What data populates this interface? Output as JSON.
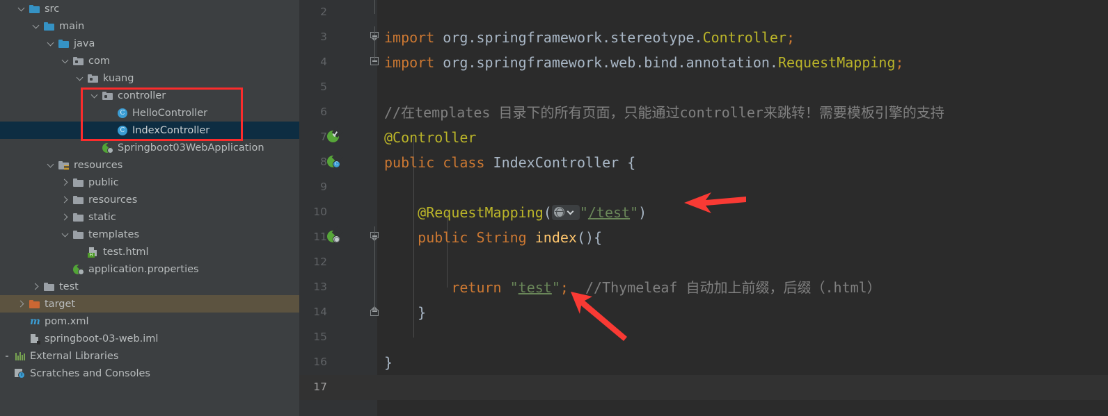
{
  "app": {
    "theme": "darcula",
    "accent_annotation_color": "#fb2c2c",
    "selection_color": "#0d2d42",
    "marked_row_color": "#5c5340"
  },
  "sidebar": {
    "name": "project-tree",
    "items": [
      {
        "label": "src",
        "icon": "folder-blue",
        "twisty": "down",
        "indent": 1,
        "state": "normal"
      },
      {
        "label": "main",
        "icon": "folder-blue",
        "twisty": "down",
        "indent": 2,
        "state": "normal"
      },
      {
        "label": "java",
        "icon": "folder-blue",
        "twisty": "down",
        "indent": 3,
        "state": "normal"
      },
      {
        "label": "com",
        "icon": "folder-package",
        "twisty": "down",
        "indent": 4,
        "state": "normal"
      },
      {
        "label": "kuang",
        "icon": "folder-package",
        "twisty": "down",
        "indent": 5,
        "state": "normal"
      },
      {
        "label": "controller",
        "icon": "folder-package",
        "twisty": "down",
        "indent": 6,
        "state": "normal"
      },
      {
        "label": "HelloController",
        "icon": "java-class",
        "twisty": "none",
        "indent": 7,
        "state": "normal"
      },
      {
        "label": "IndexController",
        "icon": "java-class",
        "twisty": "none",
        "indent": 7,
        "state": "selected"
      },
      {
        "label": "Springboot03WebApplication",
        "icon": "spring-boot-app",
        "twisty": "none",
        "indent": 6,
        "state": "normal"
      },
      {
        "label": "resources",
        "icon": "folder-resources",
        "twisty": "down",
        "indent": 3,
        "state": "normal"
      },
      {
        "label": "public",
        "icon": "folder-grey",
        "twisty": "right",
        "indent": 4,
        "state": "normal"
      },
      {
        "label": "resources",
        "icon": "folder-grey",
        "twisty": "right",
        "indent": 4,
        "state": "normal"
      },
      {
        "label": "static",
        "icon": "folder-grey",
        "twisty": "right",
        "indent": 4,
        "state": "normal"
      },
      {
        "label": "templates",
        "icon": "folder-grey",
        "twisty": "down",
        "indent": 4,
        "state": "normal"
      },
      {
        "label": "test.html",
        "icon": "html-file",
        "twisty": "none",
        "indent": 5,
        "state": "normal"
      },
      {
        "label": "application.properties",
        "icon": "spring-properties",
        "twisty": "none",
        "indent": 4,
        "state": "normal"
      },
      {
        "label": "test",
        "icon": "folder-grey",
        "twisty": "right",
        "indent": 2,
        "state": "normal"
      },
      {
        "label": "target",
        "icon": "folder-orange",
        "twisty": "right",
        "indent": 1,
        "state": "marked"
      },
      {
        "label": "pom.xml",
        "icon": "maven-file",
        "twisty": "none",
        "indent": 1,
        "state": "normal"
      },
      {
        "label": "springboot-03-web.iml",
        "icon": "iml-file",
        "twisty": "none",
        "indent": 1,
        "state": "normal"
      },
      {
        "label": "External Libraries",
        "icon": "libraries-icon",
        "twisty": "dot",
        "indent": 0,
        "state": "normal"
      },
      {
        "label": "Scratches and Consoles",
        "icon": "scratches-icon",
        "twisty": "none",
        "indent": 0,
        "state": "normal"
      }
    ],
    "annotation": {
      "type": "red-rectangle",
      "covers": [
        "controller",
        "HelloController",
        "IndexController"
      ]
    }
  },
  "editor": {
    "name": "code-editor",
    "file": "IndexController",
    "current_line": 17,
    "line_numbers": [
      2,
      3,
      4,
      5,
      6,
      7,
      8,
      9,
      10,
      11,
      12,
      13,
      14,
      15,
      16,
      17
    ],
    "gutter_icons": [
      {
        "line": 7,
        "icon": "spring-bean-checkmark-icon"
      },
      {
        "line": 8,
        "icon": "spring-bean-class-icon"
      },
      {
        "line": 11,
        "icon": "spring-request-mapping-icon"
      }
    ],
    "lines": [
      {
        "n": 2,
        "tokens": []
      },
      {
        "n": 3,
        "tokens": [
          {
            "t": "import ",
            "c": "kw"
          },
          {
            "t": "org.springframework.stereotype.",
            "c": "ident"
          },
          {
            "t": "Controller",
            "c": "ann"
          },
          {
            "t": ";",
            "c": "semi"
          }
        ]
      },
      {
        "n": 4,
        "tokens": [
          {
            "t": "import ",
            "c": "kw"
          },
          {
            "t": "org.springframework.web.bind.annotation.",
            "c": "ident"
          },
          {
            "t": "RequestMapping",
            "c": "ann"
          },
          {
            "t": ";",
            "c": "semi"
          }
        ]
      },
      {
        "n": 5,
        "tokens": []
      },
      {
        "n": 6,
        "tokens": [
          {
            "t": "//在templates 目录下的所有页面，只能通过controller来跳转！需要模板引擎的支持",
            "c": "cmt"
          }
        ]
      },
      {
        "n": 7,
        "tokens": [
          {
            "t": "@Controller",
            "c": "ann"
          }
        ]
      },
      {
        "n": 8,
        "tokens": [
          {
            "t": "public class ",
            "c": "kw"
          },
          {
            "t": "IndexController",
            "c": "typ"
          },
          {
            "t": " {",
            "c": "brace"
          }
        ]
      },
      {
        "n": 9,
        "tokens": []
      },
      {
        "n": 10,
        "tokens": [
          {
            "t": "    @RequestMapping",
            "c": "ann"
          },
          {
            "t": "(",
            "c": "punc"
          },
          {
            "t": "WEBCHIP",
            "c": "chip"
          },
          {
            "t": "\"",
            "c": "strq"
          },
          {
            "t": "/test",
            "c": "str"
          },
          {
            "t": "\"",
            "c": "strq"
          },
          {
            "t": ")",
            "c": "punc"
          }
        ]
      },
      {
        "n": 11,
        "tokens": [
          {
            "t": "    public String ",
            "c": "kw"
          },
          {
            "t": "index",
            "c": "mth"
          },
          {
            "t": "(){",
            "c": "punc"
          }
        ]
      },
      {
        "n": 12,
        "tokens": []
      },
      {
        "n": 13,
        "tokens": [
          {
            "t": "        return ",
            "c": "kw"
          },
          {
            "t": "\"",
            "c": "strq"
          },
          {
            "t": "test",
            "c": "str"
          },
          {
            "t": "\"",
            "c": "strq"
          },
          {
            "t": ";",
            "c": "semi"
          },
          {
            "t": "  //Thymeleaf 自动加上前缀，后缀（.html）",
            "c": "cmt"
          }
        ]
      },
      {
        "n": 14,
        "tokens": [
          {
            "t": "    }",
            "c": "brace"
          }
        ]
      },
      {
        "n": 15,
        "tokens": []
      },
      {
        "n": 16,
        "tokens": [
          {
            "t": "}",
            "c": "brace"
          }
        ]
      },
      {
        "n": 17,
        "tokens": []
      }
    ],
    "web_chip": {
      "icon": "globe-icon",
      "chevron": "chevron-down-icon",
      "value": "/test"
    },
    "annotations": [
      {
        "type": "red-arrow",
        "direction": "left",
        "points_at": "/test"
      },
      {
        "type": "red-arrow",
        "direction": "up-left",
        "points_at": "\"test\""
      }
    ]
  }
}
